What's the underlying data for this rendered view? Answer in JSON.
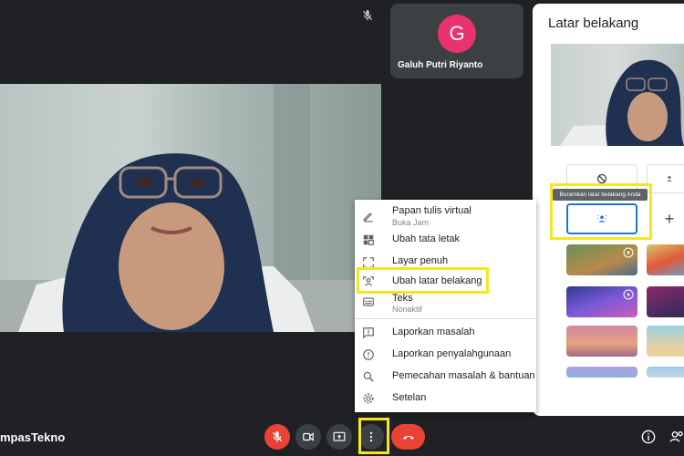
{
  "participant": {
    "initial": "G",
    "name": "Galuh Putri Riyanto"
  },
  "panel": {
    "title": "Latar belakang",
    "tooltip": "Buramkan latar belakang Anda"
  },
  "menu": {
    "items": [
      {
        "label": "Papan tulis virtual",
        "sub": "Buka Jam",
        "icon": "pen-icon"
      },
      {
        "label": "Ubah tata letak",
        "icon": "layout-icon"
      },
      {
        "label": "Layar penuh",
        "icon": "fullscreen-icon"
      },
      {
        "label": "Ubah latar belakang",
        "icon": "background-icon"
      },
      {
        "label": "Teks",
        "sub": "Nonaktif",
        "icon": "captions-icon"
      },
      {
        "label": "Laporkan masalah",
        "icon": "report-problem-icon"
      },
      {
        "label": "Laporkan penyalahgunaan",
        "icon": "report-abuse-icon"
      },
      {
        "label": "Pemecahan masalah & bantuan",
        "icon": "troubleshoot-icon"
      },
      {
        "label": "Setelan",
        "icon": "gear-icon"
      }
    ]
  },
  "footer": {
    "brand": "mpasTekno"
  },
  "colors": {
    "highlight": "#f5e623",
    "danger": "#ea4335",
    "accent": "#1a73e8",
    "avatar": "#e8336e"
  }
}
